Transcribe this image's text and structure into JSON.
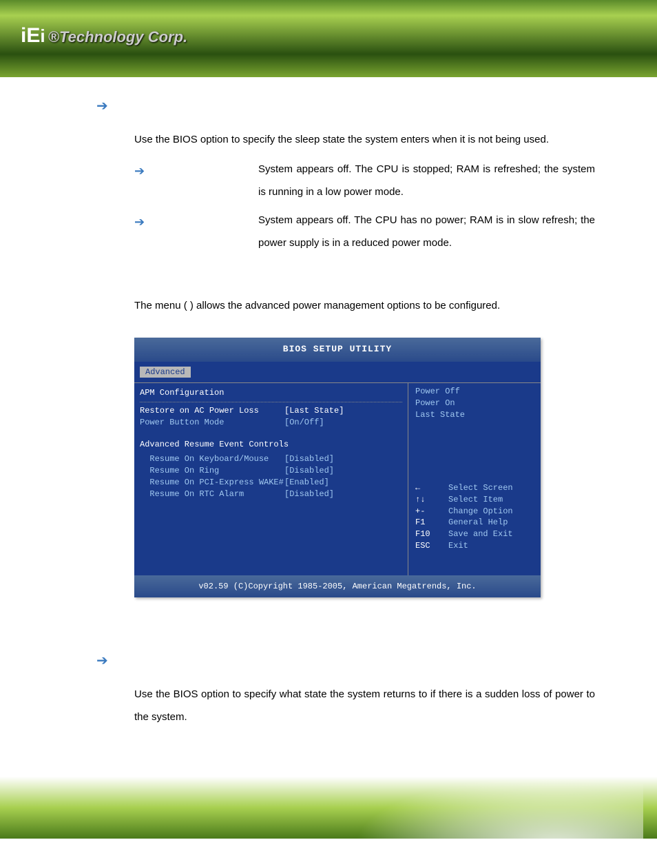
{
  "header": {
    "logo_text": "®Technology Corp."
  },
  "section1": {
    "intro": "Use the                         BIOS option to specify the sleep state the system enters when it is not being used.",
    "sub1": "System appears off. The CPU is stopped; RAM is refreshed; the system is running in a low power mode.",
    "sub2": "System appears off. The CPU has no power; RAM is in slow refresh; the power supply is in a reduced power mode."
  },
  "section2": {
    "intro": "The                                        menu   (                         )   allows  the  advanced  power management options to be configured."
  },
  "bios": {
    "title": "BIOS SETUP UTILITY",
    "tab": "Advanced",
    "heading": "APM Configuration",
    "rows": [
      {
        "label": "Restore on AC Power Loss",
        "value": "[Last State]",
        "selected": true
      },
      {
        "label": "Power Button Mode",
        "value": "[On/Off]",
        "selected": false
      }
    ],
    "heading2": "Advanced Resume Event Controls",
    "rows2": [
      {
        "label": "  Resume On Keyboard/Mouse",
        "value": "[Disabled]"
      },
      {
        "label": "  Resume On Ring",
        "value": "[Disabled]"
      },
      {
        "label": "  Resume On PCI-Express WAKE#",
        "value": "[Enabled]"
      },
      {
        "label": "  Resume On RTC Alarm",
        "value": "[Disabled]"
      }
    ],
    "options": [
      "Power Off",
      "Power On",
      "Last State"
    ],
    "help": [
      {
        "key": "←",
        "txt": "Select Screen"
      },
      {
        "key": "↑↓",
        "txt": "Select Item"
      },
      {
        "key": "+-",
        "txt": "Change Option"
      },
      {
        "key": "F1",
        "txt": "General Help"
      },
      {
        "key": "F10",
        "txt": "Save and Exit"
      },
      {
        "key": "ESC",
        "txt": "Exit"
      }
    ],
    "footer": "v02.59 (C)Copyright 1985-2005, American Megatrends, Inc."
  },
  "section3": {
    "intro": "Use  the                                                 BIOS  option  to  specify  what  state  the  system returns to if there is a sudden loss of power to the system."
  }
}
